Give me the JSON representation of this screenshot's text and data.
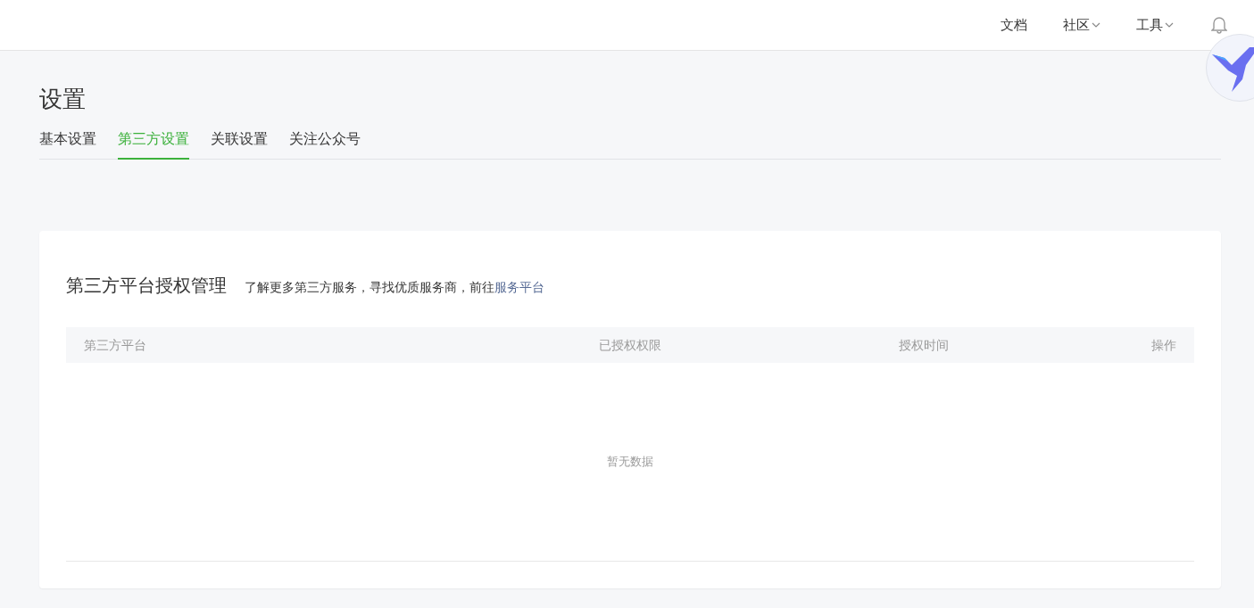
{
  "top_nav": [
    {
      "label": "文档",
      "has_menu": false
    },
    {
      "label": "社区",
      "has_menu": true
    },
    {
      "label": "工具",
      "has_menu": true
    }
  ],
  "page_title": "设置",
  "tabs": [
    {
      "label": "基本设置",
      "selected": false
    },
    {
      "label": "第三方设置",
      "selected": true
    },
    {
      "label": "关联设置",
      "selected": false
    },
    {
      "label": "关注公众号",
      "selected": false
    }
  ],
  "panel": {
    "title": "第三方平台授权管理",
    "description": "了解更多第三方服务，寻找优质服务商，前往",
    "link": "服务平台",
    "table": {
      "columns": [
        "第三方平台",
        "已授权权限",
        "授权时间",
        "操作"
      ],
      "empty_text": "暂无数据"
    }
  }
}
